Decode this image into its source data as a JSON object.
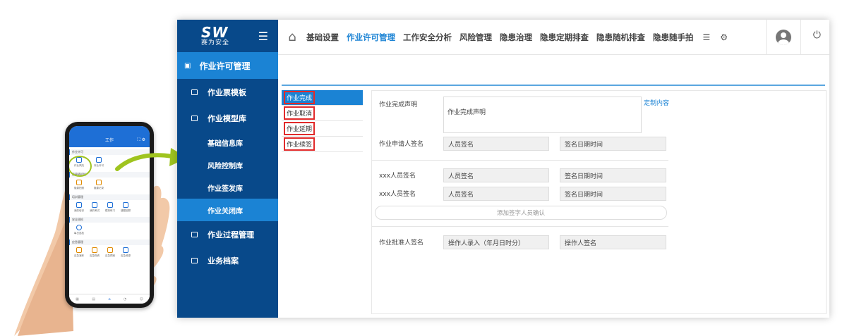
{
  "phone": {
    "title": "工作",
    "sections": [
      {
        "title": "作业许可",
        "items": [
          "作业风险",
          "作业许可"
        ]
      },
      {
        "title": "隐患随机拍",
        "items": [
          "隐患拍照",
          "隐患记录"
        ]
      },
      {
        "title": "培训管理",
        "items": [
          "我的培训",
          "我的考试",
          "模拟练习",
          "错题回顾"
        ]
      },
      {
        "title": "安全巡检",
        "items": [
          "每日巡检"
        ]
      },
      {
        "title": "应急管理",
        "items": [
          "应急演练",
          "应急物资",
          "应急预案",
          "应急资源"
        ]
      }
    ]
  },
  "app": {
    "logo": {
      "mark": "SW",
      "sub": "赛为安全"
    },
    "sidebar": {
      "header": "作业许可管理",
      "items": [
        {
          "label": "作业票模板"
        },
        {
          "label": "作业模型库"
        }
      ],
      "sub_items": [
        "基础信息库",
        "风险控制库",
        "作业签发库",
        "作业关闭库"
      ],
      "bottom_items": [
        {
          "label": "作业过程管理"
        },
        {
          "label": "业务档案"
        }
      ]
    },
    "topnav": [
      "基础设置",
      "作业许可管理",
      "工作安全分析",
      "风险管理",
      "隐患治理",
      "隐患定期排查",
      "隐患随机排查",
      "隐患随手拍"
    ],
    "left_list": [
      "作业完成",
      "作业取消",
      "作业延期",
      "作业续签"
    ],
    "form": {
      "completion_label": "作业完成声明",
      "completion_value": "作业完成声明",
      "custom_link": "定制内容",
      "applicant_label": "作业申请人签名",
      "applicant_sign": "人员签名",
      "applicant_date": "签名日期时间",
      "person1_label": "xxx人员签名",
      "person1_sign": "人员签名",
      "person1_date": "签名日期时间",
      "person2_label": "xxx人员签名",
      "person2_sign": "人员签名",
      "person2_date": "签名日期时间",
      "add_button": "添加签字人员确认",
      "approver_label": "作业批准人签名",
      "approver_entry": "操作人录入（年月日时分）",
      "approver_sign": "操作人签名"
    }
  }
}
